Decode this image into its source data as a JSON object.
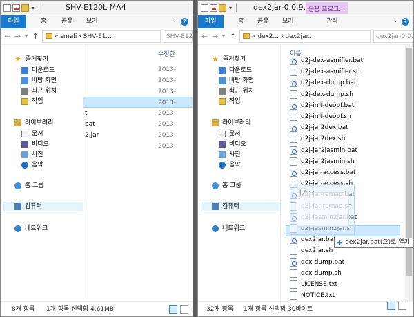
{
  "left": {
    "title": "SHV-E120L MA4",
    "tabs": [
      "파일",
      "홈",
      "공유",
      "보기"
    ],
    "breadcrumb": "« smali › SHV-E1...",
    "search_placeholder": "SHV-E120L...",
    "column_header": "수정한",
    "rows": [
      {
        "name": "",
        "date": "2013-",
        "selected": false
      },
      {
        "name": "",
        "date": "2013-",
        "selected": false
      },
      {
        "name": "",
        "date": "2013-",
        "selected": false
      },
      {
        "name": "",
        "date": "2013-",
        "selected": true
      },
      {
        "name": "t",
        "date": "2013-",
        "selected": false
      },
      {
        "name": "bat",
        "date": "2013-",
        "selected": false
      },
      {
        "name": "2.jar",
        "date": "2013-",
        "selected": false
      },
      {
        "name": "",
        "date": "2013-",
        "selected": false
      }
    ],
    "status_count": "8개 항목",
    "status_selected": "1개 항목 선택함 4.61MB"
  },
  "right": {
    "title": "dex2jar-0.0.9...",
    "context_tab": "응용 프로그...",
    "tabs": [
      "파일",
      "홈",
      "공유",
      "보기",
      "관리"
    ],
    "breadcrumb": "« dex2... › dex2jar...",
    "search_placeholder": "dex2jar-0.0...",
    "column_header": "이름",
    "files": [
      {
        "name": "d2j-dex-asmifier.bat",
        "type": "bat"
      },
      {
        "name": "d2j-dex-asmifier.sh",
        "type": "plain"
      },
      {
        "name": "d2j-dex-dump.bat",
        "type": "bat"
      },
      {
        "name": "d2j-dex-dump.sh",
        "type": "plain"
      },
      {
        "name": "d2j-init-deobf.bat",
        "type": "bat"
      },
      {
        "name": "d2j-init-deobf.sh",
        "type": "plain"
      },
      {
        "name": "d2j-jar2dex.bat",
        "type": "bat"
      },
      {
        "name": "d2j-jar2dex.sh",
        "type": "plain"
      },
      {
        "name": "d2j-jar2jasmin.bat",
        "type": "bat"
      },
      {
        "name": "d2j-jar2jasmin.sh",
        "type": "plain"
      },
      {
        "name": "d2j-jar-access.bat",
        "type": "bat"
      },
      {
        "name": "d2j-jar-access.sh",
        "type": "plain"
      },
      {
        "name": "d2j-jar-remap.bat",
        "type": "bat"
      },
      {
        "name": "d2j-jar-remap.sh",
        "type": "plain"
      },
      {
        "name": "d2j-jasmin2jar.bat",
        "type": "bat"
      },
      {
        "name": "d2j-jasmin2jar.sh",
        "type": "plain"
      },
      {
        "name": "dex2jar.bat",
        "type": "bat"
      },
      {
        "name": "dex2jar.sh",
        "type": "plain"
      },
      {
        "name": "dex-dump.bat",
        "type": "bat"
      },
      {
        "name": "dex-dump.sh",
        "type": "plain"
      },
      {
        "name": "LICENSE.txt",
        "type": "plain"
      },
      {
        "name": "NOTICE.txt",
        "type": "plain"
      }
    ],
    "drag_tooltip": "dex2jar.bat(으)로 열기",
    "status_count": "32개 항목",
    "status_selected": "1개 항목 선택함 30바이트"
  },
  "nav": {
    "favorites": "즐겨찾기",
    "downloads": "다운로드",
    "desktop": "바탕 화면",
    "recent": "최근 위치",
    "work": "작업",
    "libraries": "라이브러리",
    "documents": "문서",
    "videos": "비디오",
    "pictures": "사진",
    "music": "음악",
    "homegroup": "홈 그룹",
    "computer": "컴퓨터",
    "network": "네트워크"
  },
  "colors": {
    "accent": "#1979ca",
    "selection": "#cce8ff",
    "context_tab": "#e6c9f2"
  }
}
